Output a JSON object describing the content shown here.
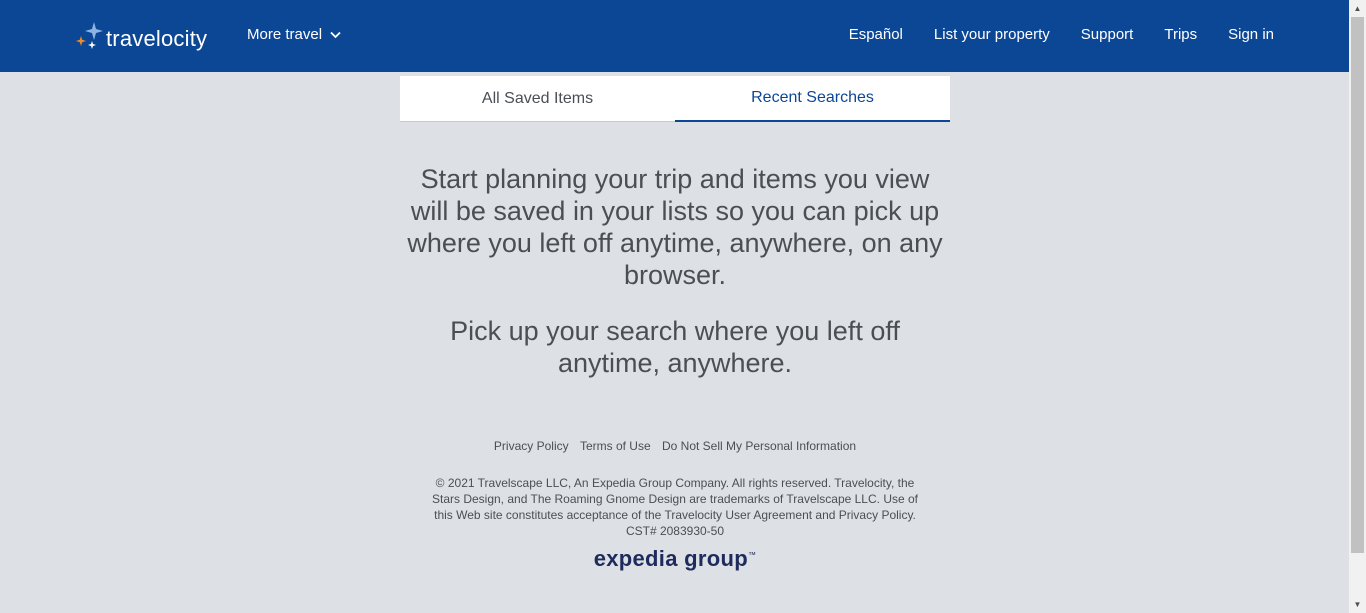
{
  "header": {
    "logo_text": "travelocity",
    "more_travel_label": "More travel",
    "nav": [
      {
        "label": "Español"
      },
      {
        "label": "List your property"
      },
      {
        "label": "Support"
      },
      {
        "label": "Trips"
      },
      {
        "label": "Sign in"
      }
    ],
    "colors": {
      "background": "#0c4796",
      "text": "#ffffff"
    }
  },
  "tabs": [
    {
      "label": "All Saved Items",
      "active": false
    },
    {
      "label": "Recent Searches",
      "active": true
    }
  ],
  "main": {
    "message_primary": "Start planning your trip and items you view will be saved in your lists so you can pick up where you left off anytime, anywhere, on any browser.",
    "message_secondary": "Pick up your search where you left off anytime, anywhere."
  },
  "footer": {
    "links": [
      {
        "label": "Privacy Policy"
      },
      {
        "label": "Terms of Use"
      },
      {
        "label": "Do Not Sell My Personal Information"
      }
    ],
    "copyright": "© 2021 Travelscape LLC, An Expedia Group Company. All rights reserved. Travelocity, the Stars Design, and The Roaming Gnome Design are trademarks of Travelscape LLC. Use of this Web site constitutes acceptance of the Travelocity User Agreement and Privacy Policy.",
    "cst": "CST# 2083930-50",
    "brand_logo": "expedia group"
  },
  "icons": {
    "logo_icon": "travelocity-stars-icon",
    "dropdown_icon": "chevron-down-icon"
  },
  "colors": {
    "page_background": "#dde1e5",
    "accent": "#0c4796",
    "text": "#4a4f55"
  }
}
